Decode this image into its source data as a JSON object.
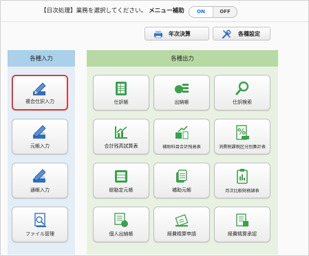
{
  "header": {
    "instruction": "【日次処理】業務を選択してください。",
    "menu_assist_label": "メニュー補助",
    "toggle_on": "ON",
    "toggle_off": "OFF",
    "buttons": {
      "nenji_kessan": "年次決算",
      "kakushu_settei": "各種設定"
    }
  },
  "left_panel": {
    "title": "各種入力",
    "items": [
      {
        "label": "複合仕訳入力",
        "icon": "pencil-icon",
        "selected": true
      },
      {
        "label": "元帳入力",
        "icon": "pencil-icon"
      },
      {
        "label": "通帳入力",
        "icon": "pencil-icon"
      },
      {
        "label": "ファイル管理",
        "icon": "file-icon"
      }
    ]
  },
  "right_panel": {
    "title": "各種出力",
    "items": [
      {
        "label": "仕訳帳",
        "icon": "journal-icon"
      },
      {
        "label": "出納帳",
        "icon": "coins-icon"
      },
      {
        "label": "仕訳検索",
        "icon": "magnifier-icon"
      },
      {
        "label": "合計残高試算表",
        "icon": "chart-icon"
      },
      {
        "label": "補助科目合計残高表",
        "icon": "chart-icon"
      },
      {
        "label": "消費税課税区分別集計表",
        "icon": "percent-icon"
      },
      {
        "label": "総勘定元帳",
        "icon": "ledger-icon"
      },
      {
        "label": "補助元帳",
        "icon": "ledger-icon"
      },
      {
        "label": "月次比較財務諸表",
        "icon": "clipboard-icon"
      },
      {
        "label": "個人出納帳",
        "icon": "person-ledger-icon"
      },
      {
        "label": "経費精算申請",
        "icon": "expense-icon"
      },
      {
        "label": "経費精算承認",
        "icon": "approve-icon"
      }
    ]
  },
  "colors": {
    "accent_green": "#3aa14b",
    "accent_blue": "#2f6fc0",
    "selected_border": "#d83a3a",
    "toggle_on": "#1e6fd9"
  }
}
